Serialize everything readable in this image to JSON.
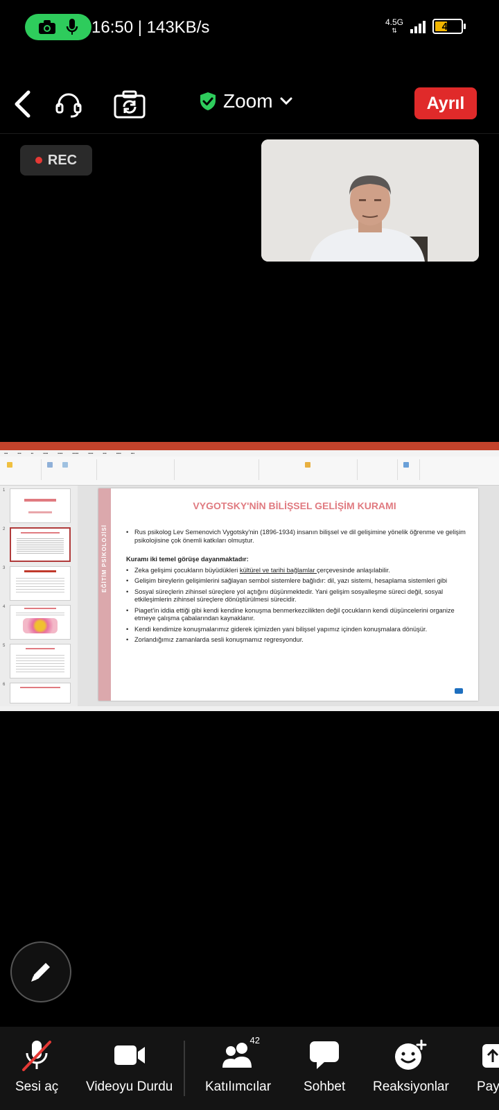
{
  "status_bar": {
    "time": "16:50 | 143KB/s",
    "network": "4.5G",
    "battery": "46",
    "battery_level": 0.46
  },
  "top_bar": {
    "meeting_title": "Zoom",
    "leave_label": "Ayrıl"
  },
  "recording": {
    "label": "REC"
  },
  "shared_slide": {
    "title": "VYGOTSKY'NİN BİLİŞSEL GELİŞİM KURAMI",
    "side_label": "EĞİTİM PSİKOLOJİSİ",
    "intro": "Rus psikolog Lev Semenovich Vygotsky'nin (1896-1934) insanın bilişsel ve dil gelişimine yönelik öğrenme ve gelişim psikolojisine çok önemli katkıları olmuştur.",
    "heading": "Kuramı iki temel görüşe dayanmaktadır:",
    "bullet1_pre": "Zeka gelişimi çocukların büyüdükleri ",
    "bullet1_underline": "kültürel ve tarihi bağlamlar ",
    "bullet1_post": "çerçevesinde anlaşılabilir.",
    "bullets": [
      "Gelişim bireylerin gelişimlerini sağlayan sembol sistemlere bağlıdır: dil, yazı sistemi, hesaplama sistemleri gibi",
      "Sosyal süreçlerin zihinsel süreçlere yol açtığını düşünmektedir. Yani gelişim sosyalleşme süreci değil, sosyal etkileşimlerin zihinsel süreçlere dönüştürülmesi sürecidir.",
      "Piaget'in iddia ettiği gibi kendi kendine konuşma benmerkezcilikten değil çocukların kendi düşüncelerini organize etmeye çalışma çabalarından kaynaklanır.",
      "Kendi kendimize konuşmalarımız giderek içimizden yani bilişsel yapımız içinden konuşmalara dönüşür.",
      "Zorlandığımız zamanlarda sesli konuşmamız regresyondur."
    ],
    "thumb_numbers": [
      "1",
      "2",
      "3",
      "4",
      "5",
      "6"
    ]
  },
  "toolbar": {
    "unmute_label": "Sesi aç",
    "video_label": "Videoyu Durdu",
    "participants_label": "Katılımcılar",
    "participants_count": "42",
    "chat_label": "Sohbet",
    "reactions_label": "Reaksiyonlar",
    "share_label": "Pay"
  },
  "colors": {
    "leave": "#e02a2a",
    "status_pill": "#2ecc5c",
    "slide_title": "#e07a80",
    "slide_side": "#dba8ac"
  }
}
